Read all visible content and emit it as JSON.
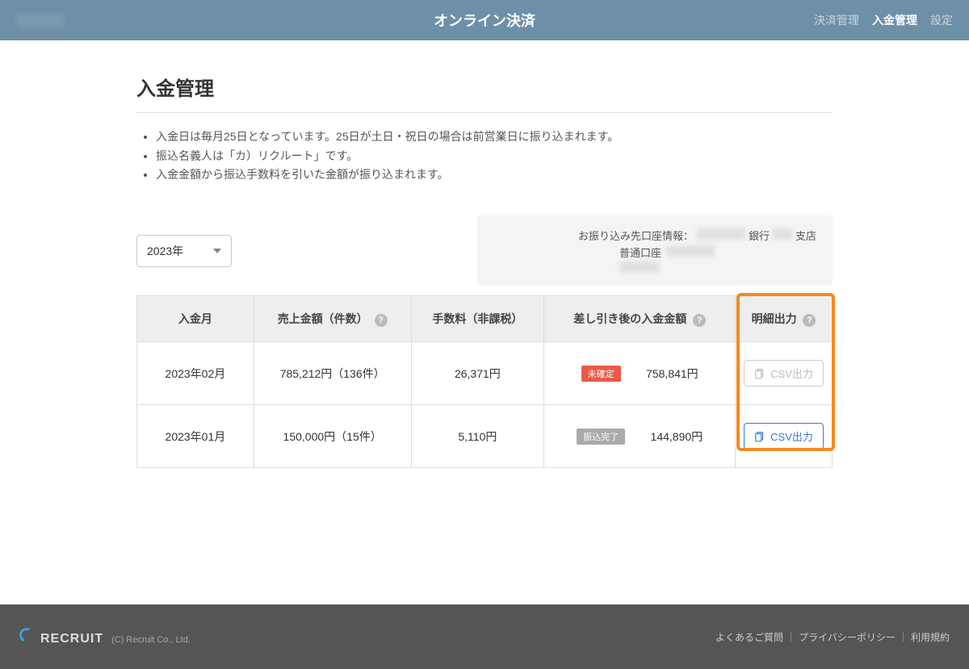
{
  "header": {
    "title": "オンライン決済",
    "nav": {
      "payment": "決済管理",
      "deposit": "入金管理",
      "settings": "設定"
    }
  },
  "page": {
    "title": "入金管理",
    "notes": [
      "入金日は毎月25日となっています。25日が土日・祝日の場合は前営業日に振り込まれます。",
      "振込名義人は「カ）リクルート」です。",
      "入金金額から振込手数料を引いた金額が振り込まれます。"
    ]
  },
  "year_select": {
    "value": "2023年"
  },
  "bank": {
    "label": "お振り込み先口座情報：",
    "bank_suffix": "銀行",
    "branch_suffix": "支店",
    "account_type": "普通口座"
  },
  "table": {
    "headers": {
      "month": "入金月",
      "sales": "売上金額（件数）",
      "fee": "手数料（非課税）",
      "net": "差し引き後の入金金額",
      "export": "明細出力"
    },
    "rows": [
      {
        "month": "2023年02月",
        "sales": "785,212円（136件）",
        "fee": "26,371円",
        "badge": "未確定",
        "badge_type": "red",
        "net": "758,841円",
        "csv_enabled": false
      },
      {
        "month": "2023年01月",
        "sales": "150,000円（15件）",
        "fee": "5,110円",
        "badge": "振込完了",
        "badge_type": "gray",
        "net": "144,890円",
        "csv_enabled": true
      }
    ],
    "csv_label": "CSV出力"
  },
  "footer": {
    "brand": "RECRUIT",
    "copyright": "(C) Recruit Co., Ltd.",
    "links": {
      "faq": "よくあるご質問",
      "privacy": "プライバシーポリシー",
      "terms": "利用規約"
    }
  }
}
